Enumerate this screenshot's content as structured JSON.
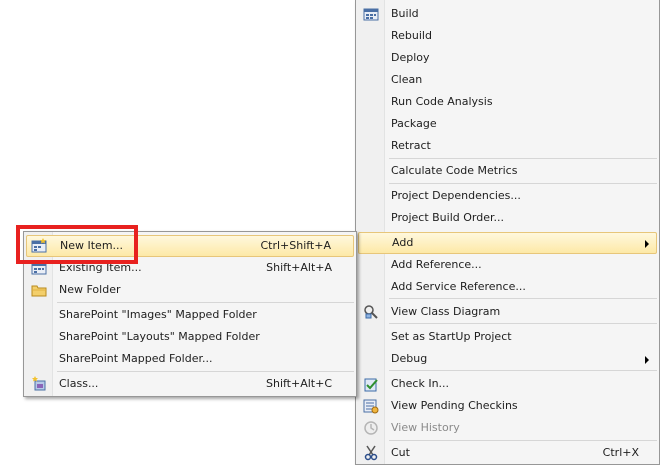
{
  "main_menu": {
    "items": [
      {
        "label": "Build",
        "icon": "build-icon"
      },
      {
        "label": "Rebuild"
      },
      {
        "label": "Deploy"
      },
      {
        "label": "Clean"
      },
      {
        "label": "Run Code Analysis"
      },
      {
        "label": "Package"
      },
      {
        "label": "Retract"
      },
      {
        "label": "Calculate Code Metrics"
      },
      {
        "label": "Project Dependencies..."
      },
      {
        "label": "Project Build Order..."
      },
      {
        "label": "Add",
        "submenu": true,
        "highlighted": true
      },
      {
        "label": "Add Reference..."
      },
      {
        "label": "Add Service Reference..."
      },
      {
        "label": "View Class Diagram",
        "icon": "class-diagram-icon"
      },
      {
        "label": "Set as StartUp Project"
      },
      {
        "label": "Debug",
        "submenu": true
      },
      {
        "label": "Check In...",
        "icon": "check-in-icon"
      },
      {
        "label": "View Pending Checkins",
        "icon": "pending-checkins-icon"
      },
      {
        "label": "View History",
        "icon": "history-icon",
        "disabled": true
      },
      {
        "label": "Cut",
        "icon": "scissors-icon",
        "shortcut": "Ctrl+X"
      }
    ]
  },
  "sub_menu": {
    "items": [
      {
        "label": "New Item...",
        "shortcut": "Ctrl+Shift+A",
        "icon": "new-item-icon",
        "highlighted": true
      },
      {
        "label": "Existing Item...",
        "shortcut": "Shift+Alt+A",
        "icon": "existing-item-icon"
      },
      {
        "label": "New Folder",
        "icon": "folder-icon"
      },
      {
        "label": "SharePoint \"Images\" Mapped Folder"
      },
      {
        "label": "SharePoint \"Layouts\" Mapped Folder"
      },
      {
        "label": "SharePoint Mapped Folder..."
      },
      {
        "label": "Class...",
        "shortcut": "Shift+Alt+C",
        "icon": "class-icon"
      }
    ]
  },
  "annotation": {
    "color": "#e8211f"
  },
  "colors": {
    "highlight": "#fde9a7",
    "menu_bg": "#f5f5f5"
  }
}
